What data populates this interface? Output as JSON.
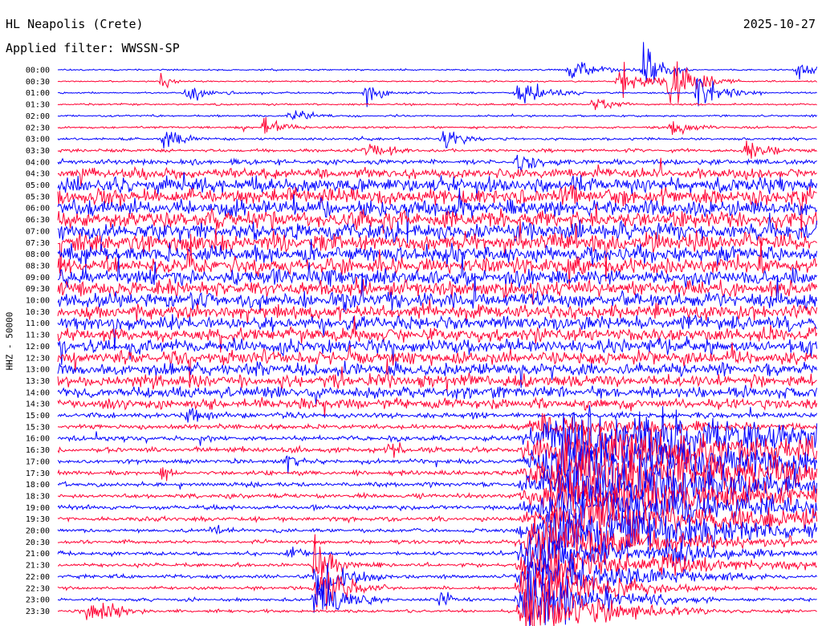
{
  "header": {
    "station": "HL Neapolis (Crete)",
    "date": "2025-10-27",
    "filter_label": "Applied filter: WWSSN-SP"
  },
  "chart_data": {
    "type": "line",
    "title": "HL Neapolis (Crete)",
    "subtitle": "Applied filter: WWSSN-SP",
    "ylabel": "HHZ - 50000",
    "xlabel": "",
    "grid": false,
    "legend": "none",
    "series_colors": [
      "#0000ff",
      "#ff0033"
    ],
    "rows": [
      {
        "time": "00:00",
        "noise": 0.25
      },
      {
        "time": "00:30",
        "noise": 0.25
      },
      {
        "time": "01:00",
        "noise": 0.3
      },
      {
        "time": "01:30",
        "noise": 0.3
      },
      {
        "time": "02:00",
        "noise": 0.3
      },
      {
        "time": "02:30",
        "noise": 0.35
      },
      {
        "time": "03:00",
        "noise": 0.4
      },
      {
        "time": "03:30",
        "noise": 0.5
      },
      {
        "time": "04:00",
        "noise": 0.8
      },
      {
        "time": "04:30",
        "noise": 1.6
      },
      {
        "time": "05:00",
        "noise": 2.4
      },
      {
        "time": "05:30",
        "noise": 2.6
      },
      {
        "time": "06:00",
        "noise": 2.6
      },
      {
        "time": "06:30",
        "noise": 2.7
      },
      {
        "time": "07:00",
        "noise": 2.7
      },
      {
        "time": "07:30",
        "noise": 2.7
      },
      {
        "time": "08:00",
        "noise": 2.6
      },
      {
        "time": "08:30",
        "noise": 2.6
      },
      {
        "time": "09:00",
        "noise": 2.5
      },
      {
        "time": "09:30",
        "noise": 2.5
      },
      {
        "time": "10:00",
        "noise": 2.4
      },
      {
        "time": "10:30",
        "noise": 2.3
      },
      {
        "time": "11:00",
        "noise": 2.3
      },
      {
        "time": "11:30",
        "noise": 2.2
      },
      {
        "time": "12:00",
        "noise": 2.2
      },
      {
        "time": "12:30",
        "noise": 2.1
      },
      {
        "time": "13:00",
        "noise": 2.0
      },
      {
        "time": "13:30",
        "noise": 1.9
      },
      {
        "time": "14:00",
        "noise": 1.8
      },
      {
        "time": "14:30",
        "noise": 1.6
      },
      {
        "time": "15:00",
        "noise": 0.9
      },
      {
        "time": "15:30",
        "noise": 0.8
      },
      {
        "time": "16:00",
        "noise": 0.8
      },
      {
        "time": "16:30",
        "noise": 0.8
      },
      {
        "time": "17:00",
        "noise": 0.7
      },
      {
        "time": "17:30",
        "noise": 0.7
      },
      {
        "time": "18:00",
        "noise": 0.7
      },
      {
        "time": "18:30",
        "noise": 0.7
      },
      {
        "time": "19:00",
        "noise": 0.7
      },
      {
        "time": "19:30",
        "noise": 0.7
      },
      {
        "time": "20:00",
        "noise": 0.6
      },
      {
        "time": "20:30",
        "noise": 0.6
      },
      {
        "time": "21:00",
        "noise": 0.6
      },
      {
        "time": "21:30",
        "noise": 0.6
      },
      {
        "time": "22:00",
        "noise": 0.6
      },
      {
        "time": "22:30",
        "noise": 0.5
      },
      {
        "time": "23:00",
        "noise": 0.5
      },
      {
        "time": "23:30",
        "noise": 0.5
      }
    ],
    "events": [
      {
        "row": 0,
        "minute": 20,
        "amp": 3,
        "dur": 3
      },
      {
        "row": 0,
        "minute": 23,
        "amp": 9,
        "dur": 2
      },
      {
        "row": 0,
        "minute": 29,
        "amp": 3,
        "dur": 2
      },
      {
        "row": 1,
        "minute": 22,
        "amp": 4,
        "dur": 4
      },
      {
        "row": 1,
        "minute": 24,
        "amp": 6,
        "dur": 3
      },
      {
        "row": 1,
        "minute": 4,
        "amp": 3,
        "dur": 1
      },
      {
        "row": 2,
        "minute": 5,
        "amp": 3,
        "dur": 2
      },
      {
        "row": 2,
        "minute": 18,
        "amp": 4,
        "dur": 3
      },
      {
        "row": 2,
        "minute": 25,
        "amp": 5,
        "dur": 3
      },
      {
        "row": 2,
        "minute": 12,
        "amp": 3,
        "dur": 2
      },
      {
        "row": 3,
        "minute": 21,
        "amp": 3,
        "dur": 2
      },
      {
        "row": 4,
        "minute": 9,
        "amp": 3,
        "dur": 2
      },
      {
        "row": 5,
        "minute": 24,
        "amp": 3,
        "dur": 2
      },
      {
        "row": 5,
        "minute": 8,
        "amp": 3,
        "dur": 2
      },
      {
        "row": 6,
        "minute": 15,
        "amp": 4,
        "dur": 2
      },
      {
        "row": 6,
        "minute": 4,
        "amp": 3,
        "dur": 2
      },
      {
        "row": 7,
        "minute": 12,
        "amp": 3,
        "dur": 2
      },
      {
        "row": 7,
        "minute": 27,
        "amp": 4,
        "dur": 2
      },
      {
        "row": 8,
        "minute": 18,
        "amp": 3,
        "dur": 2
      },
      {
        "row": 30,
        "minute": 5,
        "amp": 2,
        "dur": 2
      },
      {
        "row": 31,
        "minute": 18,
        "amp": 3,
        "dur": 14
      },
      {
        "row": 32,
        "minute": 18,
        "amp": 9,
        "dur": 30
      },
      {
        "row": 33,
        "minute": 18,
        "amp": 8,
        "dur": 30
      },
      {
        "row": 34,
        "minute": 18,
        "amp": 8,
        "dur": 30
      },
      {
        "row": 35,
        "minute": 18,
        "amp": 9,
        "dur": 30
      },
      {
        "row": 36,
        "minute": 18,
        "amp": 8,
        "dur": 30
      },
      {
        "row": 37,
        "minute": 18,
        "amp": 7,
        "dur": 30
      },
      {
        "row": 38,
        "minute": 18,
        "amp": 6,
        "dur": 30
      },
      {
        "row": 39,
        "minute": 18,
        "amp": 6,
        "dur": 30
      },
      {
        "row": 40,
        "minute": 18,
        "amp": 9,
        "dur": 20
      },
      {
        "row": 41,
        "minute": 18,
        "amp": 7,
        "dur": 14
      },
      {
        "row": 42,
        "minute": 18,
        "amp": 7,
        "dur": 12
      },
      {
        "row": 43,
        "minute": 18,
        "amp": 7,
        "dur": 12
      },
      {
        "row": 44,
        "minute": 18,
        "amp": 9,
        "dur": 10
      },
      {
        "row": 45,
        "minute": 18,
        "amp": 9,
        "dur": 8
      },
      {
        "row": 46,
        "minute": 18,
        "amp": 9,
        "dur": 8
      },
      {
        "row": 47,
        "minute": 18,
        "amp": 9,
        "dur": 8
      },
      {
        "row": 43,
        "minute": 10,
        "amp": 8,
        "dur": 2
      },
      {
        "row": 44,
        "minute": 10,
        "amp": 9,
        "dur": 3
      },
      {
        "row": 45,
        "minute": 10,
        "amp": 9,
        "dur": 3
      },
      {
        "row": 46,
        "minute": 10,
        "amp": 8,
        "dur": 3
      },
      {
        "row": 47,
        "minute": 1,
        "amp": 4,
        "dur": 3
      },
      {
        "row": 46,
        "minute": 15,
        "amp": 4,
        "dur": 1
      },
      {
        "row": 45,
        "minute": 22,
        "amp": 3,
        "dur": 1
      },
      {
        "row": 40,
        "minute": 6,
        "amp": 3,
        "dur": 1
      },
      {
        "row": 42,
        "minute": 9,
        "amp": 3,
        "dur": 1
      },
      {
        "row": 42,
        "minute": 24,
        "amp": 3,
        "dur": 2
      },
      {
        "row": 43,
        "minute": 24,
        "amp": 4,
        "dur": 2
      },
      {
        "row": 35,
        "minute": 4,
        "amp": 3,
        "dur": 1
      },
      {
        "row": 34,
        "minute": 9,
        "amp": 4,
        "dur": 1
      },
      {
        "row": 33,
        "minute": 13,
        "amp": 3,
        "dur": 1
      },
      {
        "row": 36,
        "minute": 28,
        "amp": 3,
        "dur": 1
      }
    ]
  }
}
